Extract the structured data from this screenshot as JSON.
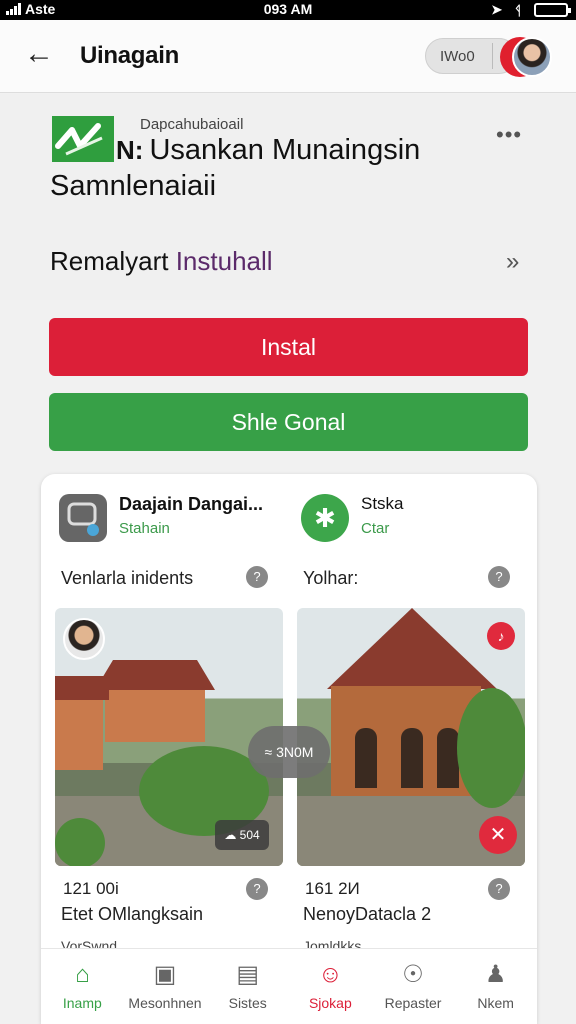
{
  "status_bar": {
    "carrier": "Aste",
    "time": "093 AM"
  },
  "header": {
    "title": "Uinagain",
    "pill_text": "IWo0"
  },
  "app": {
    "developer": "Dapcahubaioail",
    "name_prefix": "N:",
    "name": "Usankan Munaingsin Samnlenaiaii",
    "remark_main": "Remalyart ",
    "remark_accent": "Instuhall"
  },
  "buttons": {
    "install": "Instal",
    "share": "Shle Gonal"
  },
  "card": {
    "left": {
      "title": "Daajain Dangai...",
      "subtitle": "Stahain",
      "label": "Venlarla inidents",
      "number": "121 00i",
      "caption": "Etet OMlangksain",
      "cut_text": "VorSwnd",
      "photo_badge": "504"
    },
    "right": {
      "title": "Stska",
      "subtitle": "Ctar",
      "label": "Yolhar:",
      "number": "161 2И",
      "caption": "NenoyDatacla 2",
      "cut_text": "Jomldkks"
    },
    "duration_pill": "≈ 3N0M"
  },
  "bottom_nav": [
    {
      "label": "Inamp",
      "icon": "home-icon"
    },
    {
      "label": "Mesonhnen",
      "icon": "grid-icon"
    },
    {
      "label": "Sistes",
      "icon": "list-icon"
    },
    {
      "label": "Sjokap",
      "icon": "person-icon"
    },
    {
      "label": "Repaster",
      "icon": "compass-icon"
    },
    {
      "label": "Nkem",
      "icon": "profile-icon"
    }
  ],
  "colors": {
    "red": "#dc1f38",
    "green": "#37a047"
  }
}
